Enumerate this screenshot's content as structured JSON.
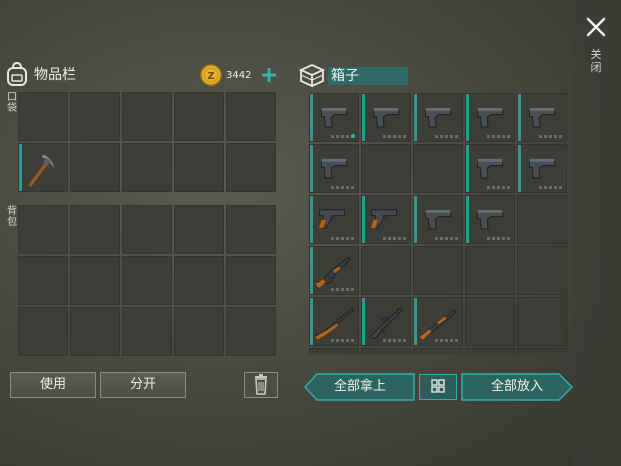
{
  "inventory": {
    "title": "物品栏",
    "coins": "3442",
    "pocket_label": "口袋",
    "backpack_label": "背包"
  },
  "box": {
    "title": "箱子"
  },
  "close": {
    "label": "关闭"
  },
  "buttons": {
    "use": "使用",
    "split": "分开",
    "take_all": "全部拿上",
    "put_all": "全部放入"
  },
  "pocket_slots": [
    {
      "item": "empty"
    },
    {
      "item": "empty"
    },
    {
      "item": "empty"
    },
    {
      "item": "empty"
    },
    {
      "item": "empty"
    },
    {
      "item": "pickaxe"
    },
    {
      "item": "empty"
    },
    {
      "item": "empty"
    },
    {
      "item": "empty"
    },
    {
      "item": "empty"
    }
  ],
  "backpack_slots": 15,
  "box_slots": [
    {
      "item": "pistol"
    },
    {
      "item": "pistol"
    },
    {
      "item": "pistol"
    },
    {
      "item": "pistol"
    },
    {
      "item": "pistol"
    },
    {
      "item": "pistol"
    },
    {
      "item": "empty"
    },
    {
      "item": "empty"
    },
    {
      "item": "pistol"
    },
    {
      "item": "pistol"
    },
    {
      "item": "mauser-pistol"
    },
    {
      "item": "mauser-pistol"
    },
    {
      "item": "pistol"
    },
    {
      "item": "pistol"
    },
    {
      "item": "empty"
    },
    {
      "item": "ak-rifle"
    },
    {
      "item": "empty"
    },
    {
      "item": "empty"
    },
    {
      "item": "empty"
    },
    {
      "item": "empty"
    },
    {
      "item": "hunting-rifle"
    },
    {
      "item": "assault-rifle"
    },
    {
      "item": "shotgun"
    },
    {
      "item": "empty"
    },
    {
      "item": "empty"
    },
    {
      "item": "empty"
    },
    {
      "item": "empty"
    },
    {
      "item": "empty"
    },
    {
      "item": "empty"
    },
    {
      "item": "empty"
    }
  ],
  "colors": {
    "accent": "#2e9a92",
    "coin": "#e3b52c",
    "cell": "#3c3d37"
  }
}
